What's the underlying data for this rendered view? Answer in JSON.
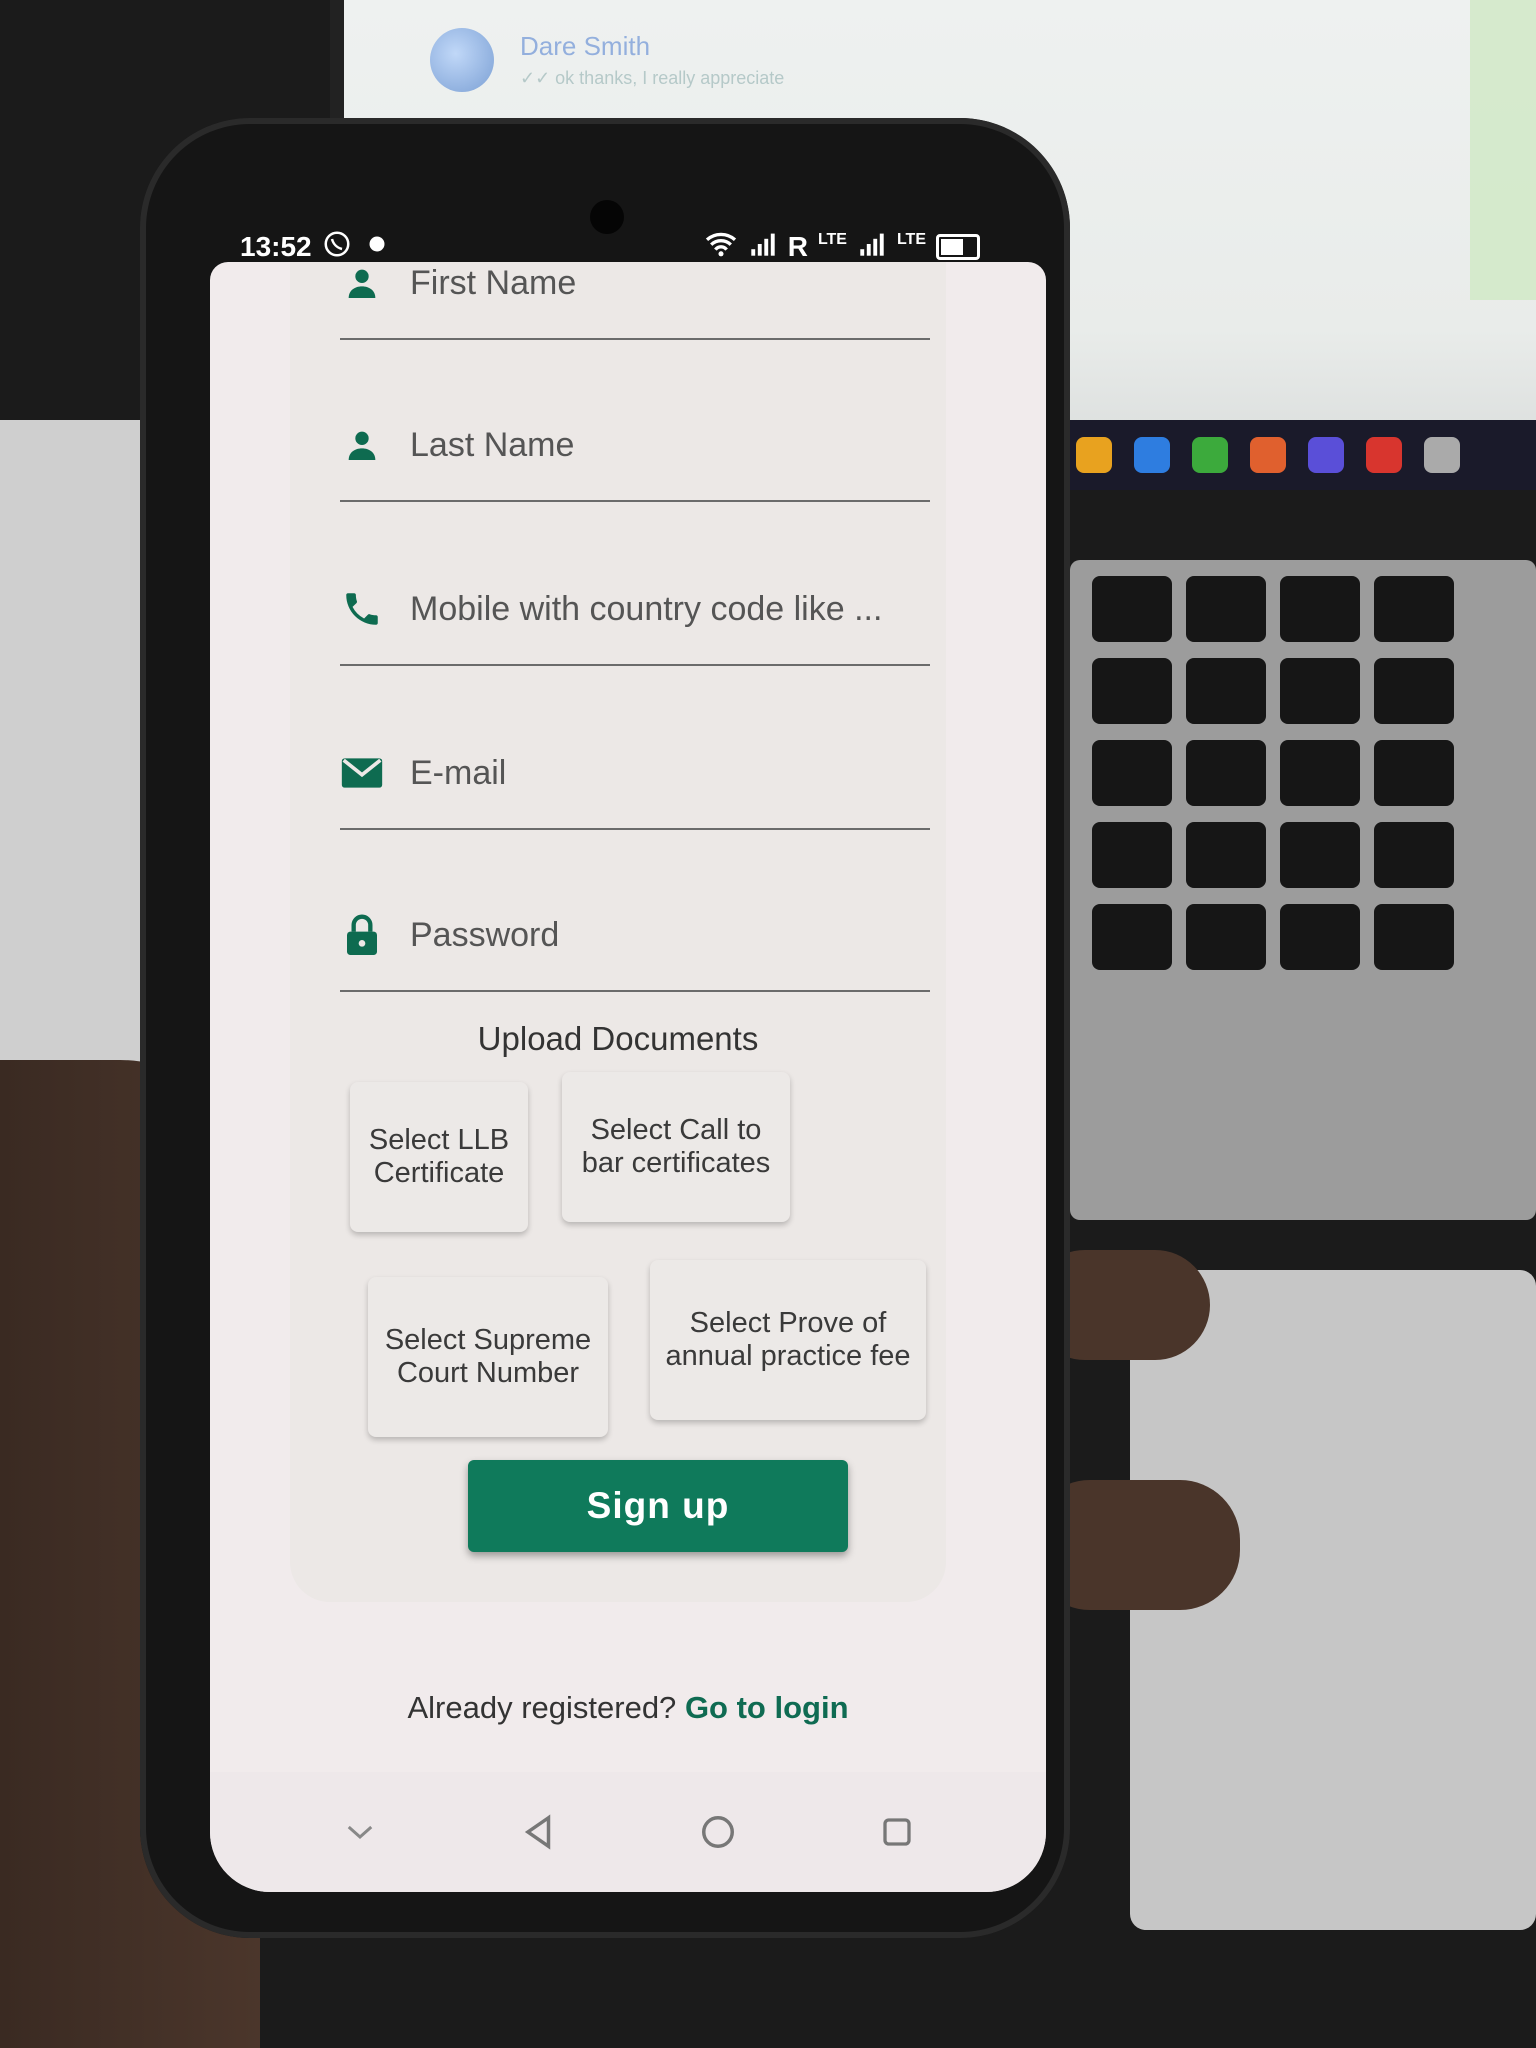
{
  "status_bar": {
    "time": "13:52",
    "network": "R",
    "lte_1": "LTE",
    "lte_2": "LTE"
  },
  "background": {
    "chat_contact_name": "Dare Smith",
    "chat_contact_preview": "✓✓ ok thanks, I really appreciate"
  },
  "form": {
    "fields": [
      {
        "label": "First Name",
        "icon": "person-icon"
      },
      {
        "label": "Last Name",
        "icon": "person-icon"
      },
      {
        "label": "Mobile with country code like ...",
        "icon": "phone-icon"
      },
      {
        "label": "E-mail",
        "icon": "mail-icon"
      },
      {
        "label": "Password",
        "icon": "lock-icon"
      }
    ],
    "upload_title": "Upload Documents",
    "documents": [
      "Select LLB Certificate",
      "Select Call to bar certificates",
      "Select Supreme Court Number",
      "Select Prove of annual practice fee"
    ],
    "signup_label": "Sign up"
  },
  "footer": {
    "prompt": "Already registered?",
    "login_link": "Go to login"
  },
  "nav": {
    "icons": [
      "chevron-down-icon",
      "back-icon",
      "home-icon",
      "recents-icon"
    ]
  },
  "colors": {
    "accent": "#0f7a5b",
    "icon": "#0e6b50",
    "screen_bg": "#f1ebec"
  }
}
